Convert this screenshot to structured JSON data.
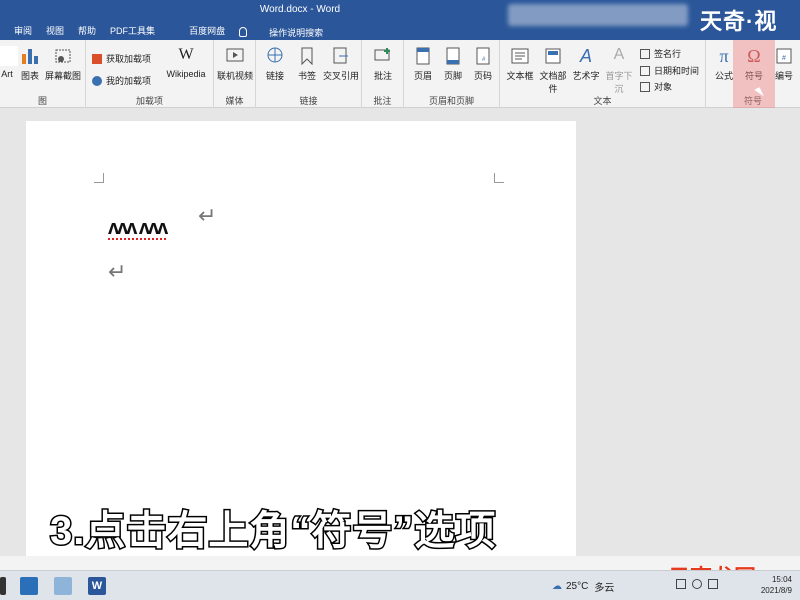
{
  "window": {
    "title": "Word.docx  -  Word"
  },
  "menu": {
    "items": [
      "审阅",
      "视图",
      "帮助",
      "PDF工具集"
    ],
    "netdisk": "百度网盘",
    "tell_me": "操作说明搜索"
  },
  "watermark_top": "天奇·视",
  "ribbon": {
    "groups": {
      "illustrations": {
        "label": "图",
        "buttons": [
          "Art",
          "图表",
          "屏幕截图"
        ]
      },
      "addins": {
        "label": "加载项",
        "get": "获取加载项",
        "my": "我的加载项",
        "wiki": "Wikipedia"
      },
      "media": {
        "label": "媒体",
        "button": "联机视频"
      },
      "links": {
        "label": "链接",
        "buttons": [
          "链接",
          "书签",
          "交叉引用"
        ]
      },
      "comments": {
        "label": "批注",
        "button": "批注"
      },
      "header_footer": {
        "label": "页眉和页脚",
        "buttons": [
          "页眉",
          "页脚",
          "页码"
        ]
      },
      "text": {
        "label": "文本",
        "buttons": [
          "文本框",
          "文档部件",
          "艺术字",
          "首字下沉"
        ],
        "signature": "签名行",
        "datetime": "日期和时间",
        "object": "对象"
      },
      "symbols": {
        "label": "符号",
        "buttons": [
          "公式",
          "符号",
          "编号"
        ]
      }
    }
  },
  "document": {
    "line1": "ʌʌʌ ʌʌʌ",
    "pilcrow": "↵"
  },
  "caption": "3.点击右上角“符号”选项",
  "watermark_bottom": "云南龙网",
  "taskbar": {
    "weather_temp": "25°C",
    "weather_desc": "多云",
    "time": "15:04",
    "date": "2021/8/9"
  },
  "colors": {
    "title_bar": "#2b579a",
    "highlight": "#f08282"
  }
}
